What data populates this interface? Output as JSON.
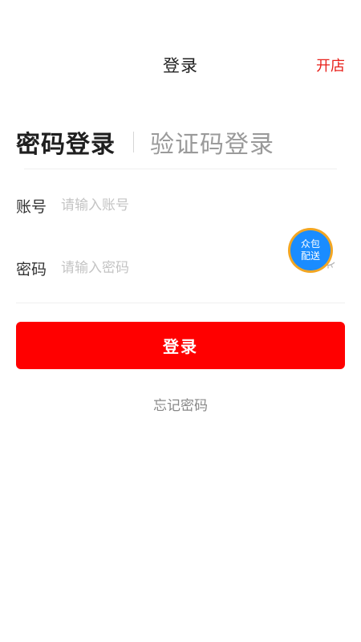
{
  "header": {
    "title": "登录",
    "action": "开店",
    "accent_color": "#e8211b"
  },
  "tabs": [
    {
      "label": "密码登录",
      "active": true
    },
    {
      "label": "验证码登录",
      "active": false
    }
  ],
  "form": {
    "account": {
      "label": "账号",
      "value": "",
      "placeholder": "请输入账号"
    },
    "password": {
      "label": "密码",
      "value": "",
      "placeholder": "请输入密码"
    },
    "password_toggle_icon": "eye-closed-icon"
  },
  "badge": {
    "line1": "众包",
    "line2": "配送",
    "color": "#1a8cff"
  },
  "login_button": {
    "label": "登录",
    "color": "#ff0000"
  },
  "forgot_password": "忘记密码"
}
